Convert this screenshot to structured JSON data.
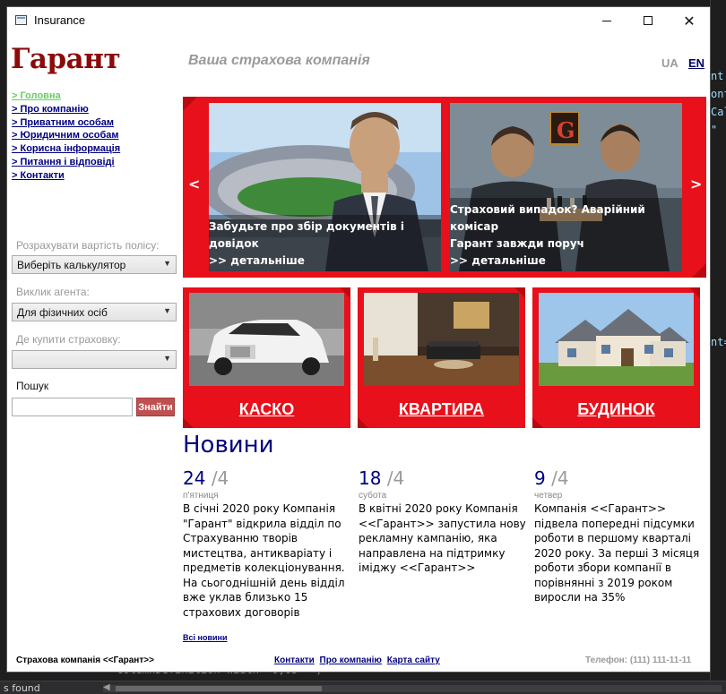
{
  "window": {
    "title": "Insurance"
  },
  "header": {
    "brand": "Гарант",
    "tagline": "Ваша страхова компанія",
    "lang_ua": "UA",
    "lang_en": "EN"
  },
  "nav": {
    "items": [
      {
        "label": "> Головна",
        "active": true
      },
      {
        "label": "> Про компанію"
      },
      {
        "label": "> Приватним особам"
      },
      {
        "label": "> Юридичним особам"
      },
      {
        "label": "> Корисна інформація"
      },
      {
        "label": "> Питання і відповіді"
      },
      {
        "label": "> Контакти"
      }
    ]
  },
  "sidebar": {
    "calc_label": "Розрахувати вартість полісу:",
    "calc_value": "Виберіть калькулятор",
    "agent_label": "Виклик агента:",
    "agent_value": "Для фізичних осіб",
    "buy_label": "Де купити страховку:",
    "buy_value": "",
    "search_label": "Пошук",
    "search_value": "",
    "search_button": "Знайти"
  },
  "slider": {
    "prev": "<",
    "next": ">",
    "slides": [
      {
        "line1": "Забудьте про збір документів і довідок",
        "line2": ">> детальніше"
      },
      {
        "line1": "Страховий випадок? Аварійний комісар",
        "line2": "Гарант завжди поруч",
        "line3": ">> детальніше"
      }
    ]
  },
  "tiles": [
    {
      "title": "КАСКО"
    },
    {
      "title": "КВАРТИРА"
    },
    {
      "title": "БУДИНОК"
    }
  ],
  "news": {
    "heading": "Новини",
    "items": [
      {
        "day": "24",
        "month": "/4",
        "weekday": "п'ятниця",
        "text": "В січні 2020 року Компанія \"Гарант\" відкрила відділ по Страхуванню творів мистецтва, антикваріату і предметів колекціонування. На сьогоднішній день відділ вже уклав близько 15 страхових договорів"
      },
      {
        "day": "18",
        "month": "/4",
        "weekday": "субота",
        "text": "В квітні 2020 року Компанія <<Гарант>> запустила нову рекламну кампанію, яка направлена на підтримку іміджу <<Гарант>>"
      },
      {
        "day": "9",
        "month": "/4",
        "weekday": "четвер",
        "text": "Компанія <<Гарант>> підвела попередні підсумки роботи в першому кварталі 2020 року. За перші 3 місяця роботи збори компанії в порівнянні з 2019 роком виросли на 35%"
      }
    ],
    "all_link": "Всі новини"
  },
  "footer": {
    "company": "Страхова компанія <<Гарант>>",
    "links": [
      "Контакти",
      "Про компанію",
      "Карта сайту"
    ],
    "phone": "Телефон: (111) 111-11-11"
  },
  "background": {
    "status": "s found",
    "code_line": "ColumnDefinition Width=\"0,05*\" />"
  },
  "colors": {
    "brand": "#8b0a0a",
    "accent_red": "#e8101a",
    "link": "#000080",
    "muted": "#9a9a9a"
  }
}
